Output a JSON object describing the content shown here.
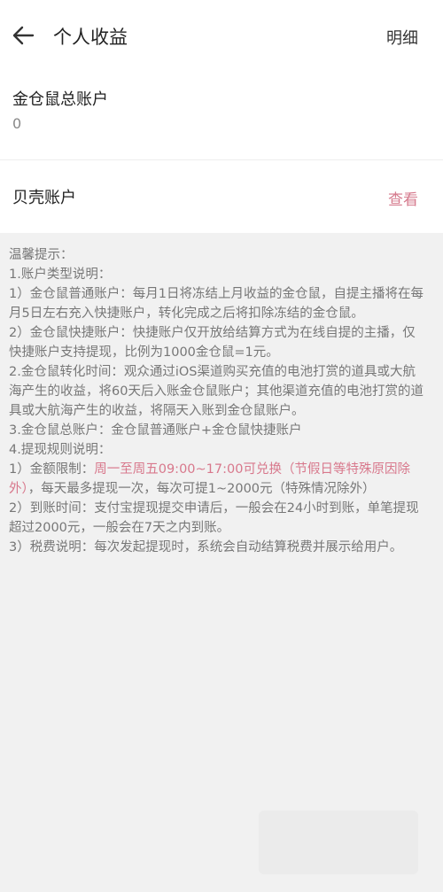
{
  "header": {
    "title": "个人收益",
    "detail_label": "明细"
  },
  "accounts": {
    "total": {
      "label": "金仓鼠总账户",
      "value": "0"
    },
    "shell": {
      "label": "贝壳账户",
      "link": "查看"
    }
  },
  "tips": {
    "heading": "温馨提示：",
    "s1": "1.账户类型说明：",
    "s1_1": "1）金仓鼠普通账户：每月1日将冻结上月收益的金仓鼠，自提主播将在每月5日左右充入快捷账户，转化完成之后将扣除冻结的金仓鼠。",
    "s1_2": "2）金仓鼠快捷账户：快捷账户仅开放给结算方式为在线自提的主播，仅快捷账户支持提现，比例为1000金仓鼠=1元。",
    "s2": "2.金仓鼠转化时间：观众通过iOS渠道购买充值的电池打赏的道具或大航海产生的收益，将60天后入账金仓鼠账户；其他渠道充值的电池打赏的道具或大航海产生的收益，将隔天入账到金仓鼠账户。",
    "s3": "3.金仓鼠总账户：金仓鼠普通账户+金仓鼠快捷账户",
    "s4": "4.提现规则说明：",
    "s4_1a": "1）金额限制：",
    "s4_1b": "周一至周五09:00~17:00可兑换（节假日等特殊原因除外）",
    "s4_1c": "，每天最多提现一次，每次可提1~2000元（特殊情况除外）",
    "s4_2": "2）到账时间：支付宝提现提交申请后，一般会在24小时到账，单笔提现超过2000元，一般会在7天之内到账。",
    "s4_3": "3）税费说明：每次发起提现时，系统会自动结算税费并展示给用户。"
  }
}
